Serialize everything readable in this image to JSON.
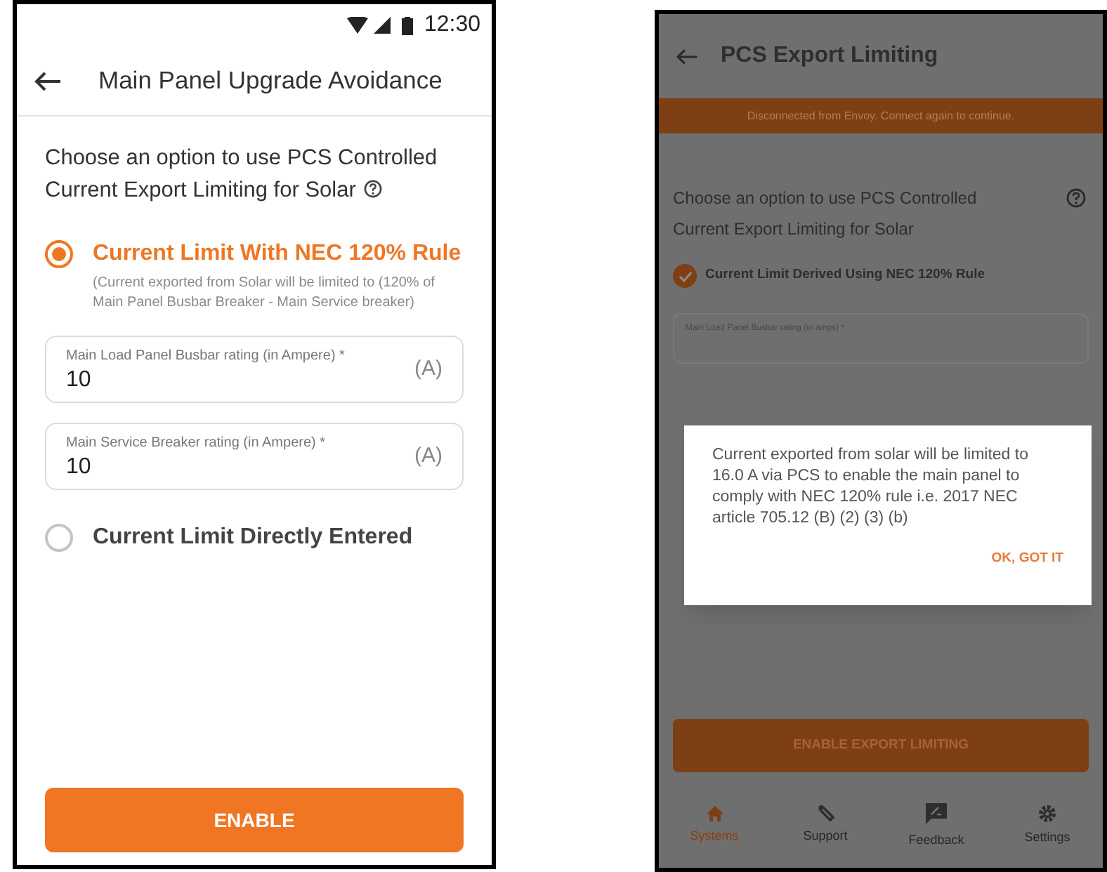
{
  "left_screen": {
    "status_bar": {
      "time": "12:30"
    },
    "title": "Main Panel Upgrade Avoidance",
    "intro": "Choose an option to use PCS Controlled Current Export Limiting for Solar",
    "options": [
      {
        "label": "Current Limit With NEC 120% Rule",
        "selected": true,
        "description": "(Current exported from Solar will be limited to (120% of Main Panel Busbar Breaker - Main Service breaker)",
        "fields": [
          {
            "label": "Main Load Panel Busbar rating (in Ampere) *",
            "value": "10",
            "unit": "(A)"
          },
          {
            "label": "Main Service Breaker rating (in Ampere) *",
            "value": "10",
            "unit": "(A)"
          }
        ]
      },
      {
        "label": "Current Limit Directly Entered",
        "selected": false
      }
    ],
    "button": "ENABLE"
  },
  "right_screen": {
    "title": "PCS Export Limiting",
    "banner": "Disconnected from Envoy. Connect again to continue.",
    "intro": "Choose an option to use PCS Controlled Current Export Limiting for Solar",
    "option": {
      "label": "Current Limit Derived Using NEC 120% Rule",
      "checked": true
    },
    "field_label": "Main Load Panel Busbar rating (in amps) *",
    "dialog": {
      "message": "Current exported from solar will be limited to 16.0 A via PCS to enable the main panel to comply with NEC 120% rule i.e. 2017 NEC article 705.12 (B) (2) (3) (b)",
      "action": "OK, GOT IT"
    },
    "button": "ENABLE EXPORT LIMITING",
    "nav": [
      {
        "label": "Systems",
        "selected": true
      },
      {
        "label": "Support",
        "selected": false
      },
      {
        "label": "Feedback",
        "selected": false
      },
      {
        "label": "Settings",
        "selected": false
      }
    ]
  }
}
